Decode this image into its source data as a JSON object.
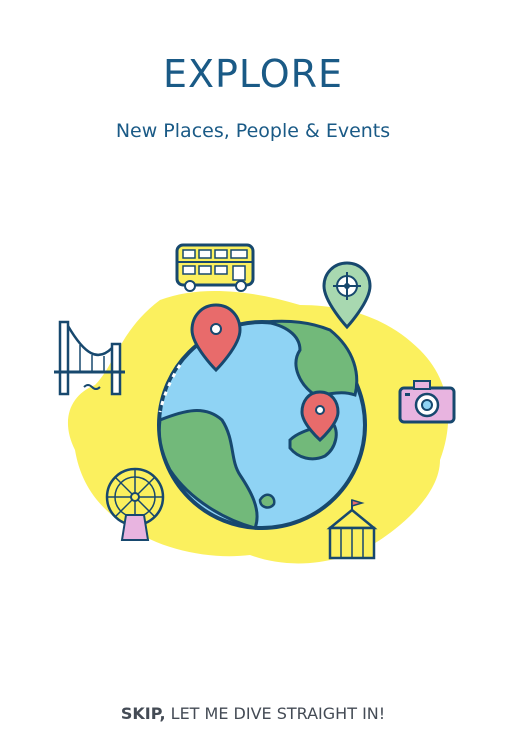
{
  "onboarding": {
    "title": "EXPLORE",
    "subtitle": "New Places, People & Events",
    "skip_bold": "SKIP,",
    "skip_rest": " LET ME DIVE STRAIGHT IN!"
  },
  "colors": {
    "title": "#1a5a86",
    "blob": "#fbf05e",
    "ocean": "#8fd3f4",
    "land": "#72b97a",
    "pin": "#e86b6b",
    "outline": "#17486e"
  },
  "icons": [
    "globe-icon",
    "bus-icon",
    "location-target-icon",
    "camera-icon",
    "circus-tent-icon",
    "ferris-wheel-icon",
    "bridge-icon",
    "map-pin-icon"
  ]
}
